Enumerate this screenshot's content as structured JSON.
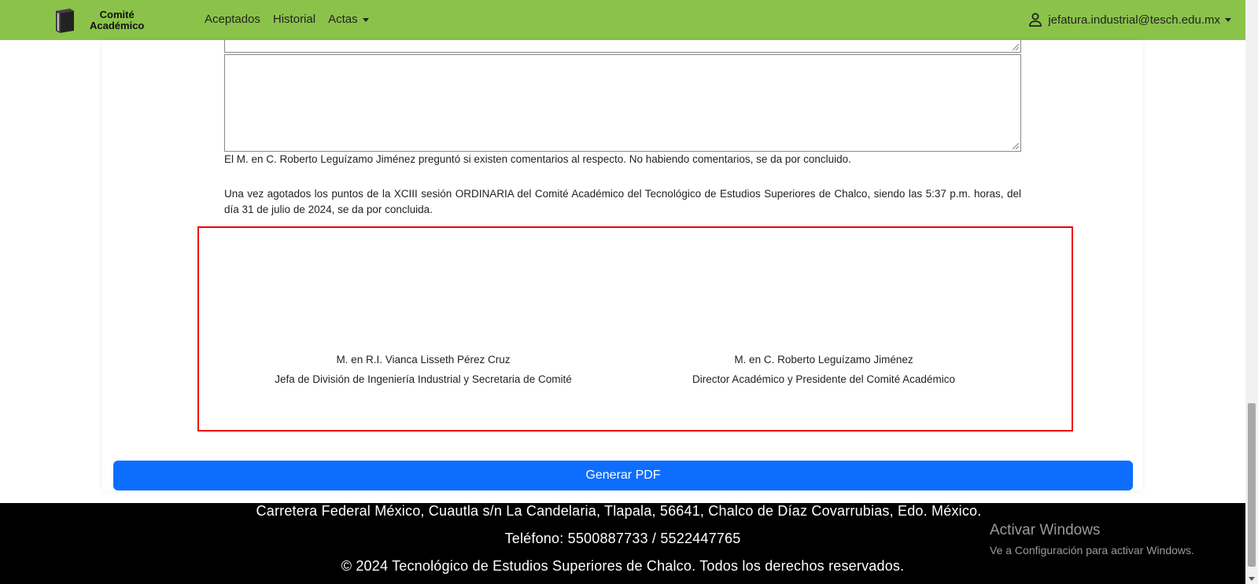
{
  "navbar": {
    "brand_line1": "Comité",
    "brand_line2": "Académico",
    "links": [
      "Aceptados",
      "Historial",
      "Actas"
    ],
    "user_email": "jefatura.industrial@tesch.edu.mx",
    "background_color": "#8bc34a"
  },
  "content": {
    "closing_comment": "El M. en C. Roberto Leguízamo Jiménez preguntó si existen comentarios al respecto. No habiendo comentarios, se da por concluido.",
    "closing_statement": "Una vez agotados los puntos de la XCIII sesión ORDINARIA del Comité Académico del Tecnológico de Estudios Superiores de Chalco, siendo las 5:37 p.m. horas, del día 31 de julio de 2024, se da por concluida.",
    "signatures": [
      {
        "name": "M. en R.I. Vianca Lisseth Pérez Cruz",
        "role": "Jefa de División de Ingeniería Industrial y Secretaria de Comité"
      },
      {
        "name": "M. en C. Roberto Leguízamo Jiménez",
        "role": "Director Académico y Presidente del Comité Académico"
      }
    ],
    "generate_pdf_label": "Generar PDF",
    "button_color": "#0d6efd",
    "highlight_border_color": "#ee0000"
  },
  "footer": {
    "address": "Carretera Federal México, Cuautla s/n La Candelaria, Tlapala, 56641, Chalco de Díaz Covarrubias, Edo. México.",
    "phone": "Teléfono: 5500887733 / 5522447765",
    "copyright": "© 2024 Tecnológico de Estudios Superiores de Chalco. Todos los derechos reservados."
  },
  "watermark": {
    "title": "Activar Windows",
    "subtitle": "Ve a Configuración para activar Windows."
  },
  "icons": [
    "book-icon",
    "user-icon",
    "caret-down-icon"
  ]
}
